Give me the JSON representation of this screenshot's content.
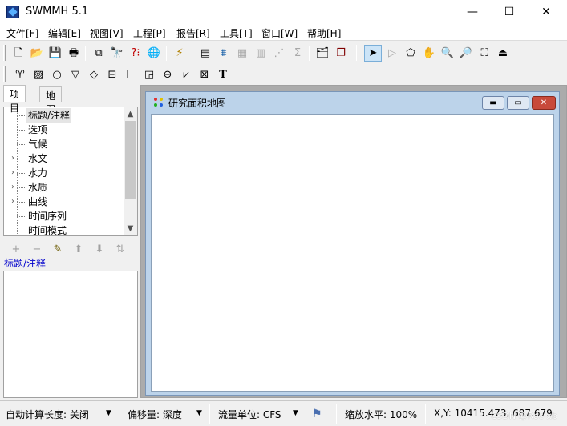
{
  "window": {
    "title": "SWMMH 5.1",
    "controls": {
      "minimize": "—",
      "maximize": "☐",
      "close": "✕"
    }
  },
  "menu": [
    "文件[F]",
    "编辑[E]",
    "视图[V]",
    "工程[P]",
    "报告[R]",
    "工具[T]",
    "窗口[W]",
    "帮助[H]"
  ],
  "toolbar1": [
    {
      "name": "new-file-icon",
      "glyph": "🗋"
    },
    {
      "name": "open-folder-icon",
      "glyph": "📂"
    },
    {
      "name": "save-icon",
      "glyph": "💾"
    },
    {
      "name": "print-icon",
      "glyph": "🖶"
    },
    {
      "name": "copy-icon",
      "glyph": "⧉"
    },
    {
      "name": "find-icon",
      "glyph": "🔭"
    },
    {
      "name": "query-icon",
      "glyph": "?⁝"
    },
    {
      "name": "globe-icon",
      "glyph": "🌐"
    },
    {
      "name": "run-icon",
      "glyph": "⚡"
    },
    {
      "name": "report-icon",
      "glyph": "▤"
    },
    {
      "name": "profile-plot-icon",
      "glyph": "⩩"
    },
    {
      "name": "time-series-icon",
      "glyph": "▦"
    },
    {
      "name": "table-icon",
      "glyph": "▥"
    },
    {
      "name": "scatter-icon",
      "glyph": "⋰"
    },
    {
      "name": "statistics-icon",
      "glyph": "Σ"
    },
    {
      "name": "options-icon",
      "glyph": "🗂"
    },
    {
      "name": "arrange-windows-icon",
      "glyph": "❐"
    },
    {
      "name": "select-pointer-icon",
      "glyph": "➤"
    },
    {
      "name": "select-vertex-icon",
      "glyph": "▷"
    },
    {
      "name": "select-region-icon",
      "glyph": "⬠"
    },
    {
      "name": "pan-icon",
      "glyph": "✋"
    },
    {
      "name": "zoom-in-icon",
      "glyph": "🔍"
    },
    {
      "name": "zoom-out-icon",
      "glyph": "🔎"
    },
    {
      "name": "full-extent-icon",
      "glyph": "⛶"
    },
    {
      "name": "measure-icon",
      "glyph": "⏏"
    }
  ],
  "toolbar2": [
    {
      "name": "rain-gage-icon",
      "glyph": "♈"
    },
    {
      "name": "subcatchment-icon",
      "glyph": "▨"
    },
    {
      "name": "junction-icon",
      "glyph": "○"
    },
    {
      "name": "outfall-icon",
      "glyph": "▽"
    },
    {
      "name": "divider-icon",
      "glyph": "◇"
    },
    {
      "name": "storage-icon",
      "glyph": "⊟"
    },
    {
      "name": "conduit-icon",
      "glyph": "⊢"
    },
    {
      "name": "pump-icon",
      "glyph": "◲"
    },
    {
      "name": "orifice-icon",
      "glyph": "⊖"
    },
    {
      "name": "weir-icon",
      "glyph": "⩗"
    },
    {
      "name": "outlet-icon",
      "glyph": "⊠"
    },
    {
      "name": "label-icon",
      "glyph": "T"
    }
  ],
  "panel": {
    "tabs": [
      "项目",
      "地图"
    ],
    "tree": [
      {
        "label": "标题/注释",
        "expandable": false,
        "selected": true
      },
      {
        "label": "选项",
        "expandable": false
      },
      {
        "label": "气候",
        "expandable": false
      },
      {
        "label": "水文",
        "expandable": true
      },
      {
        "label": "水力",
        "expandable": true
      },
      {
        "label": "水质",
        "expandable": true
      },
      {
        "label": "曲线",
        "expandable": true
      },
      {
        "label": "时间序列",
        "expandable": false
      },
      {
        "label": "时间模式",
        "expandable": false
      }
    ],
    "scroll": {
      "up": "▲",
      "down": "▼"
    },
    "mini_toolbar": [
      {
        "name": "add-object-icon",
        "glyph": "+",
        "enabled": false
      },
      {
        "name": "delete-object-icon",
        "glyph": "−",
        "enabled": false
      },
      {
        "name": "edit-object-icon",
        "glyph": "✎",
        "enabled": true
      },
      {
        "name": "move-up-icon",
        "glyph": "⬆",
        "enabled": false
      },
      {
        "name": "move-down-icon",
        "glyph": "⬇",
        "enabled": false
      },
      {
        "name": "sort-icon",
        "glyph": "⇅",
        "enabled": false
      }
    ],
    "section_label": "标题/注释"
  },
  "map_window": {
    "title": "研究面积地图",
    "controls": {
      "minimize": "▬",
      "maximize": "▭",
      "close": "✕"
    }
  },
  "status": {
    "auto_length": "自动计算长度: 关闭",
    "offsets": "偏移量: 深度",
    "flow_units": "流量单位: CFS",
    "zoom": "缩放水平: 100%",
    "coords": "X,Y: 10415.473, 687.679",
    "dropdown": "▼",
    "watermark": "CSDN @Roc-xb"
  },
  "colors": {
    "accent": "#1a3e8c",
    "map_frame": "#bcd3ea",
    "section_label": "#0000cc"
  }
}
